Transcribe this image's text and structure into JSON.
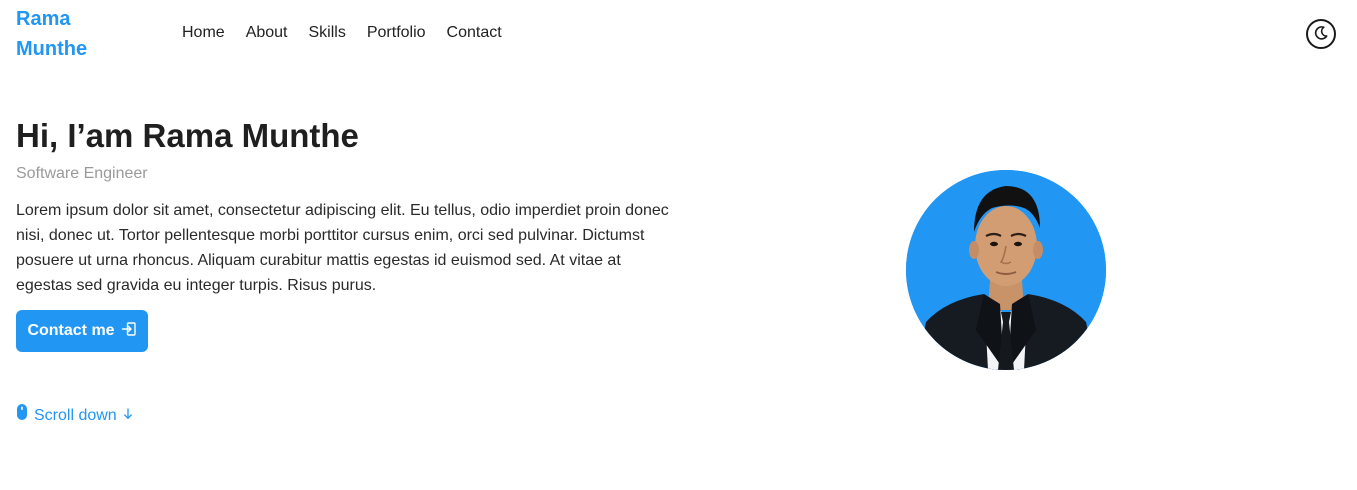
{
  "header": {
    "logo": "Rama\nMunthe",
    "nav": [
      {
        "label": "Home"
      },
      {
        "label": "About"
      },
      {
        "label": "Skills"
      },
      {
        "label": "Portfolio"
      },
      {
        "label": "Contact"
      }
    ],
    "theme_toggle_icon": "moon-icon"
  },
  "hero": {
    "title": "Hi, I’am Rama Munthe",
    "subtitle": "Software Engineer",
    "description": "Lorem ipsum dolor sit amet, consectetur adipiscing elit. Eu tellus, odio imperdiet proin donec nisi, donec ut. Tortor pellentesque morbi porttitor cursus enim, orci sed pulvinar. Dictumst posuere ut urna rhoncus. Aliquam curabitur mattis egestas id euismod sed. At vitae at egestas sed gravida eu integer turpis. Risus purus.",
    "contact_button": "Contact me",
    "contact_icon": "send-icon",
    "scroll_label": "Scroll down",
    "scroll_icon": "mouse-icon",
    "arrow_icon": "arrow-down-icon"
  },
  "colors": {
    "accent": "#2196F3",
    "text": "#1f1f1f",
    "muted": "#9a9a9a"
  }
}
